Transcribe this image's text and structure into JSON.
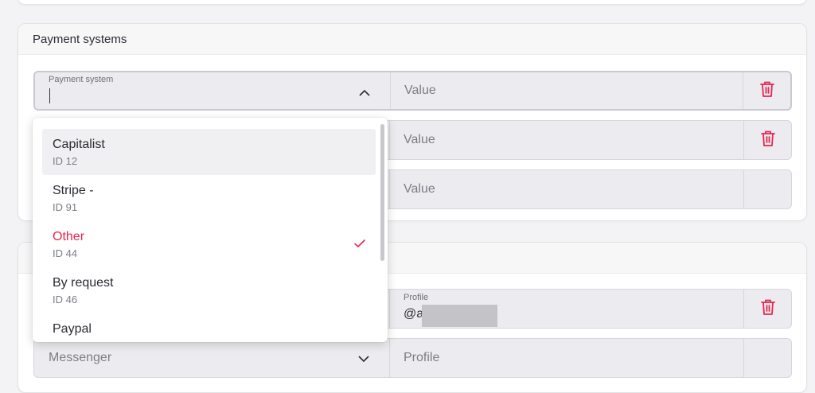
{
  "colors": {
    "accent": "#e8264f",
    "field_bg": "#ececf0",
    "text_muted": "#7c7c86"
  },
  "payment_card": {
    "title": "Payment systems",
    "rows": [
      {
        "select_label": "Payment system",
        "value_placeholder": "Value",
        "trash_icon": "trash-icon"
      },
      {
        "value_placeholder": "Value",
        "trash_icon": "trash-icon"
      },
      {
        "value_placeholder": "Value"
      }
    ]
  },
  "dropdown": {
    "options": [
      {
        "name": "Capitalist",
        "id": "ID 12",
        "state": "hover"
      },
      {
        "name": "Stripe -",
        "id": "ID 91"
      },
      {
        "name": "Other",
        "id": "ID 44",
        "state": "selected"
      },
      {
        "name": "By request",
        "id": "ID 46"
      },
      {
        "name": "Paypal",
        "id": ""
      }
    ]
  },
  "messenger_card": {
    "rows": [
      {
        "profile_label": "Profile",
        "profile_value": "@a"
      },
      {
        "select_placeholder": "Messenger",
        "profile_placeholder": "Profile"
      }
    ]
  }
}
